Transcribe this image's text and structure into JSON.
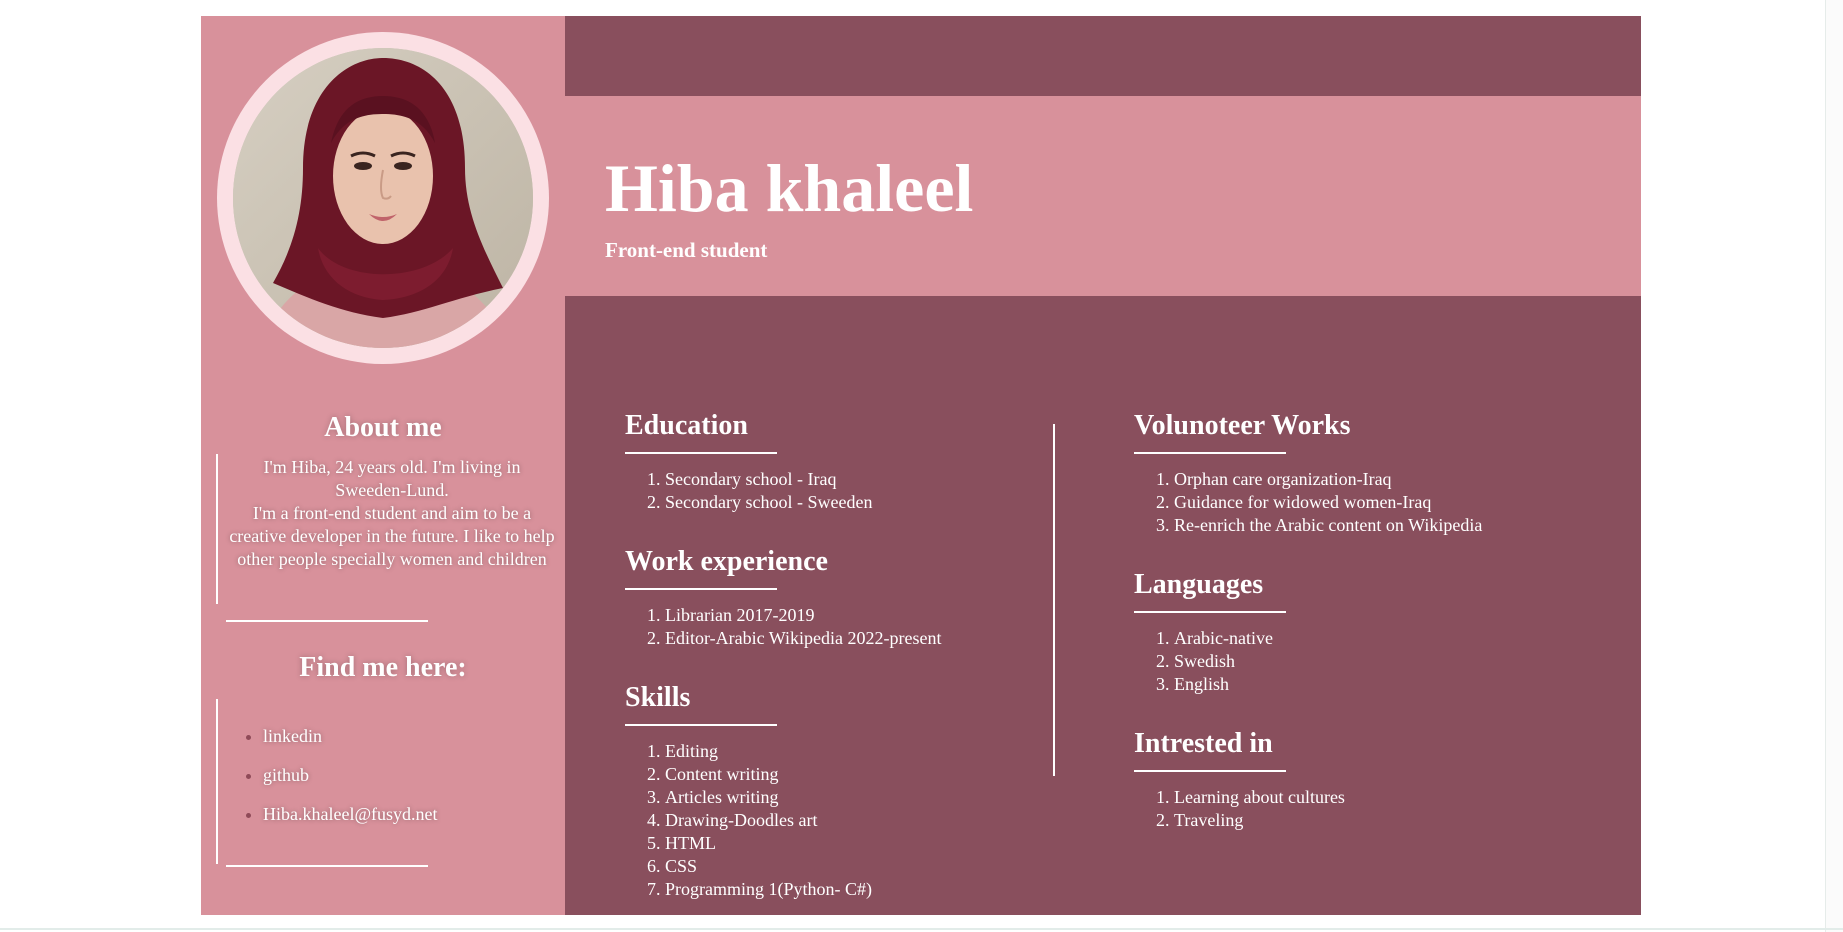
{
  "header": {
    "name": "Hiba khaleel",
    "subtitle": "Front-end student"
  },
  "sidebar": {
    "avatar_alt": "profile photo",
    "about_title": "About me",
    "about_text": "I'm Hiba, 24 years old. I'm living in Sweeden-Lund.\nI'm a front-end student and aim to be a creative developer in the future. I like to help other people specially women and children",
    "find_title": "Find me here:",
    "links": [
      "linkedin",
      "github",
      "Hiba.khaleel@fusyd.net"
    ]
  },
  "sections": {
    "education": {
      "title": "Education",
      "items": [
        "Secondary school - Iraq",
        "Secondary school - Sweeden"
      ]
    },
    "work": {
      "title": "Work experience",
      "items": [
        "Librarian 2017-2019",
        "Editor-Arabic Wikipedia 2022-present"
      ]
    },
    "skills": {
      "title": "Skills",
      "items": [
        "Editing",
        "Content writing",
        "Articles writing",
        "Drawing-Doodles art",
        "HTML",
        "CSS",
        "Programming 1(Python- C#)"
      ]
    },
    "volunteer": {
      "title": "Volunoteer Works",
      "items": [
        "Orphan care organization-Iraq",
        "Guidance for widowed women-Iraq",
        "Re-enrich the Arabic content on Wikipedia"
      ]
    },
    "languages": {
      "title": "Languages",
      "items": [
        "Arabic-native",
        "Swedish",
        "English"
      ]
    },
    "interests": {
      "title": "Intrested in",
      "items": [
        "Learning about cultures",
        "Traveling"
      ]
    }
  },
  "colors": {
    "pink": "#d8919b",
    "plum": "#894f5d",
    "avatar_ring": "#fbe0e4",
    "text": "#ffffff"
  }
}
